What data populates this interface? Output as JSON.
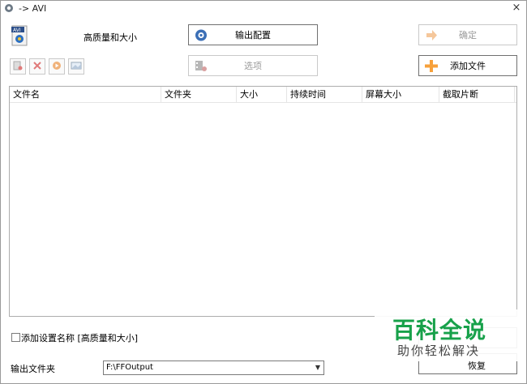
{
  "window": {
    "title": "-> AVI",
    "close_glyph": "×"
  },
  "profile": {
    "name": "高质量和大小",
    "icon": "avi-file-icon"
  },
  "buttons": {
    "output_config": "输出配置",
    "options": "选项",
    "confirm": "确定",
    "add_file": "添加文件",
    "restore_fragment": "恢复"
  },
  "small_toolbar": [
    "remove-file-icon",
    "delete-icon",
    "play-icon",
    "image-icon"
  ],
  "table": {
    "columns": [
      "文件名",
      "文件夹",
      "大小",
      "持续时间",
      "屏幕大小",
      "截取片断"
    ]
  },
  "bottom": {
    "append_name_label": "添加设置名称 [高质量和大小]",
    "output_folder_label": "输出文件夹",
    "output_folder_value": "F:\\FFOutput"
  },
  "watermark": {
    "line1": "百科全说",
    "line2": "助你轻松解决"
  },
  "colors": {
    "accent_orange": "#f7a13b",
    "watermark_green": "#17a14a"
  }
}
